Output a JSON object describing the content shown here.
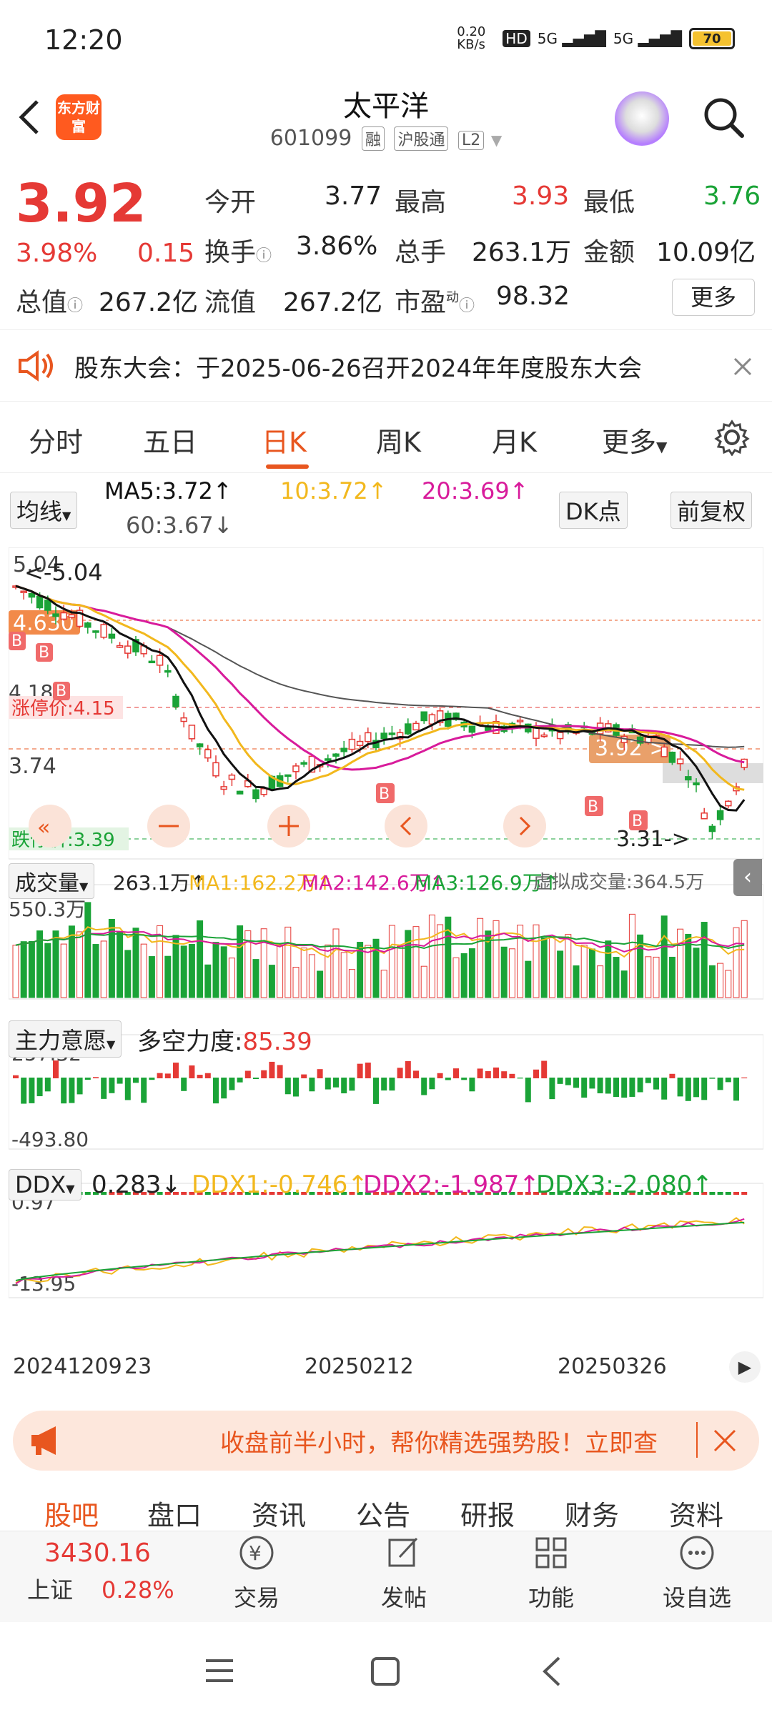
{
  "status": {
    "time": "12:20",
    "net_speed": "0.20 KB/s",
    "hd": "HD",
    "signal1": "5G",
    "signal2": "5G",
    "battery": "70"
  },
  "header": {
    "back_icon": "chevron-left-icon",
    "logo_text": "东方财富",
    "stock_name": "太平洋",
    "stock_code": "601099",
    "tag1": "融",
    "tag2": "沪股通",
    "tag3": "L2"
  },
  "quote": {
    "price": "3.92",
    "pct": "3.98%",
    "change": "0.15",
    "open_label": "今开",
    "open": "3.77",
    "high_label": "最高",
    "high": "3.93",
    "low_label": "最低",
    "low": "3.76",
    "turnover_label": "换手",
    "turnover": "3.86%",
    "vol_label": "总手",
    "vol": "263.1万",
    "amount_label": "金额",
    "amount": "10.09亿",
    "mcap_label": "总值",
    "mcap": "267.2亿",
    "float_label": "流值",
    "float": "267.2亿",
    "pe_label": "市盈",
    "pe_sup": "动",
    "pe": "98.32",
    "more": "更多"
  },
  "notice": {
    "text": "股东大会：于2025-06-26召开2024年年度股东大会"
  },
  "tabs": [
    "分时",
    "五日",
    "日K",
    "周K",
    "月K",
    "更多"
  ],
  "active_tab": "日K",
  "ma": {
    "selector": "均线",
    "ma5": "MA5:3.72↑",
    "ma10": "10:3.72↑",
    "ma20": "20:3.69↑",
    "ma60": "60:3.67↓",
    "dk": "DK点",
    "fq": "前复权"
  },
  "chart_labels": {
    "top_price": "5.04",
    "high_marker": "<-5.04",
    "orange_tag": "4.630",
    "limit_up": "涨停价:4.15",
    "mid_price": "4.18",
    "low_price": "3.74",
    "limit_down": "跌停价:3.39",
    "current_tag": "3.92 >",
    "low_marker": "3.31->",
    "b": "B"
  },
  "volume": {
    "selector": "成交量",
    "v": "263.1万↑",
    "ma1": "MA1:162.2万↑",
    "ma2": "MA2:142.6万↑",
    "ma3": "MA3:126.9万↑",
    "virtual": "虚拟成交量:364.5万",
    "axis_max": "550.3万"
  },
  "force": {
    "selector": "主力意愿",
    "label": "多空力度:",
    "value": "85.39",
    "axis_max": "257.32",
    "axis_min": "-493.80"
  },
  "ddx": {
    "selector": "DDX",
    "ddx": "0.283↓",
    "ddx1": "DDX1:-0.746↑",
    "ddx2": "DDX2:-1.987↑",
    "ddx3": "DDX3:-2.080↑",
    "axis_max": "0.97",
    "axis_min": "-13.95"
  },
  "x_axis": {
    "d1": "20241209",
    "d1b": "23",
    "d2": "20250212",
    "d3": "20250326"
  },
  "ad": {
    "text": "收盘前半小时，帮你精选强势股！立即查"
  },
  "func_tabs": [
    "股吧",
    "盘口",
    "资讯",
    "公告",
    "研报",
    "财务",
    "资料"
  ],
  "footer": {
    "index_value": "3430.16",
    "index_name": "上证",
    "index_pct": "0.28%",
    "trade": "交易",
    "post": "发帖",
    "func": "功能",
    "watch": "设自选"
  },
  "colors": {
    "up": "#e53935",
    "down": "#1aa337",
    "accent": "#e8561f",
    "ma5": "#111111",
    "ma10": "#f2b81d",
    "ma20": "#d81b9b",
    "ma60": "#555555"
  }
}
